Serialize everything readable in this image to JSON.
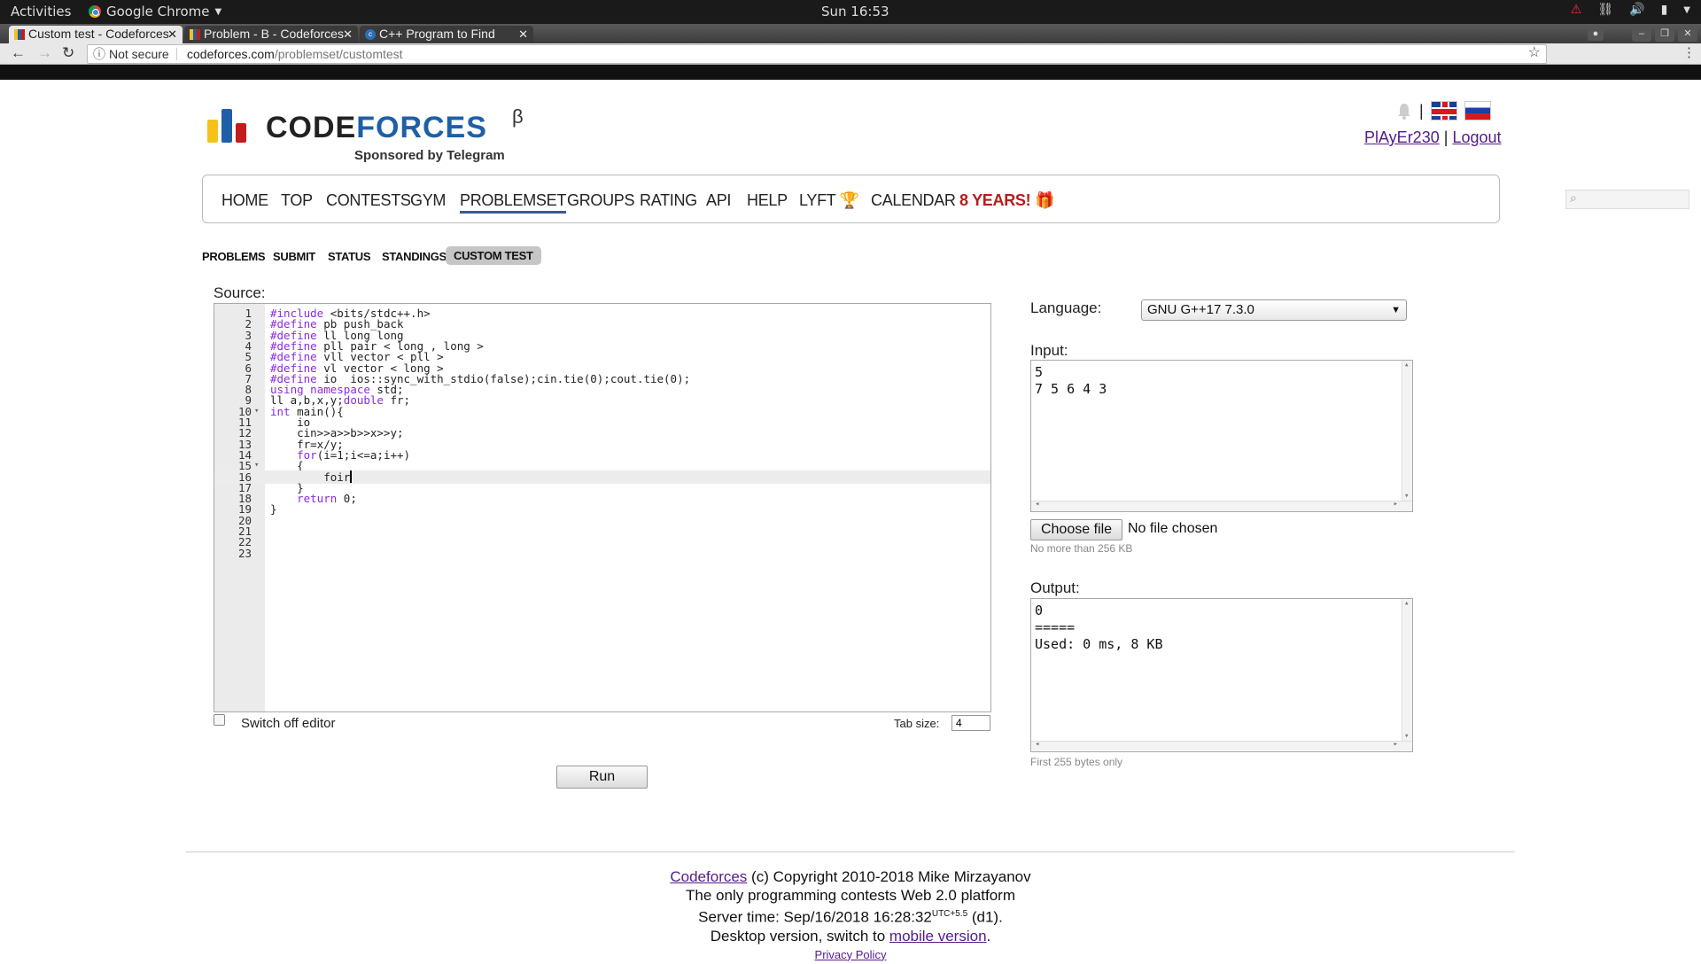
{
  "system": {
    "activities": "Activities",
    "app_name": "Google Chrome",
    "clock": "Sun 16:53"
  },
  "browser": {
    "tabs": [
      {
        "title": "Custom test - Codeforces",
        "active": true
      },
      {
        "title": "Problem - B - Codeforces",
        "active": false
      },
      {
        "title": "C++ Program to Find",
        "active": false
      }
    ],
    "security_label": "Not secure",
    "url_host": "codeforces.com",
    "url_path": "/problemset/customtest"
  },
  "header": {
    "logo_part1": "CODE",
    "logo_part2": "FORCES",
    "logo_beta": "β",
    "sponsor": "Sponsored by Telegram",
    "username": "PlAyEr230",
    "separator": "|",
    "logout": "Logout"
  },
  "main_menu": {
    "items": [
      "HOME",
      "TOP",
      "CONTESTS",
      "GYM",
      "PROBLEMSET",
      "GROUPS",
      "RATING",
      "API",
      "HELP",
      "LYFT",
      "CALENDAR",
      "8 YEARS!"
    ],
    "active": "PROBLEMSET"
  },
  "sub_menu": {
    "items": [
      "PROBLEMS",
      "SUBMIT",
      "STATUS",
      "STANDINGS",
      "CUSTOM TEST"
    ],
    "active": "CUSTOM TEST"
  },
  "source": {
    "label": "Source:",
    "current_line": 16,
    "lines": [
      "#include <bits/stdc++.h>",
      "#define pb push_back",
      "#define ll long long",
      "#define pll pair < long , long >",
      "#define vll vector < pll >",
      "#define vl vector < long >",
      "#define io  ios::sync_with_stdio(false);cin.tie(0);cout.tie(0);",
      "using namespace std;",
      "ll a,b,x,y;double fr;",
      "int main(){",
      "    io",
      "    cin>>a>>b>>x>>y;",
      "    fr=x/y;",
      "    for(i=1;i<=a;i++)",
      "    {",
      "        foir",
      "    }",
      "    return 0;",
      "}",
      "",
      "",
      "",
      ""
    ],
    "fold_lines": [
      10,
      15
    ],
    "switch_off_label": "Switch off editor",
    "tab_size_label": "Tab size:",
    "tab_size_value": "4",
    "run_label": "Run"
  },
  "settings": {
    "language_label": "Language:",
    "language_value": "GNU G++17 7.3.0",
    "input_label": "Input:",
    "input_value": "5\n7 5 6 4 3",
    "choose_file_label": "Choose file",
    "no_file_label": "No file chosen",
    "input_hint": "No more than 256 KB",
    "output_label": "Output:",
    "output_value": "0\n=====\nUsed: 0 ms, 8 KB",
    "output_hint": "First 255 bytes only"
  },
  "footer": {
    "site_link": "Codeforces",
    "copyright": " (c) Copyright 2010-2018 Mike Mirzayanov",
    "tagline": "The only programming contests Web 2.0 platform",
    "server_time_prefix": "Server time: Sep/16/2018 16:28:32",
    "utc": "UTC+5.5",
    "server_suffix": " (d1).",
    "desktop_prefix": "Desktop version, switch to ",
    "mobile_link": "mobile version",
    "desktop_suffix": ".",
    "privacy": "Privacy Policy"
  }
}
